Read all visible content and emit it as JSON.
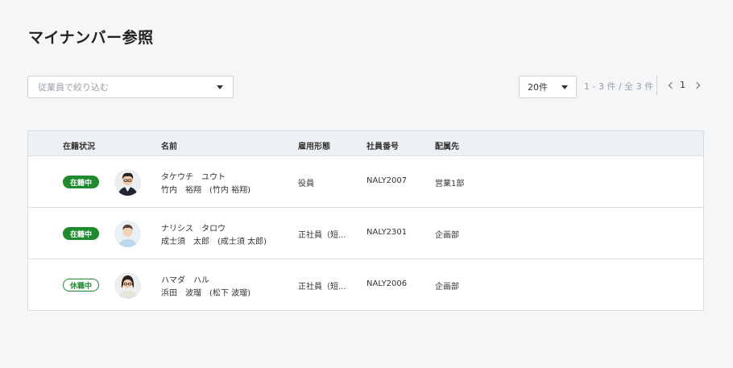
{
  "page": {
    "title": "マイナンバー参照"
  },
  "filter": {
    "placeholder": "従業員で絞り込む"
  },
  "pagination": {
    "per_page": "20件",
    "range": "1 - 3 件 / 全 3 件",
    "current_page": "1"
  },
  "table": {
    "headers": {
      "status": "在籍状況",
      "name": "名前",
      "employment": "雇用形態",
      "employee_no": "社員番号",
      "department": "配属先"
    },
    "rows": [
      {
        "status": "在籍中",
        "status_type": "active",
        "name_kana": "タケウチ　ユウト",
        "name_kanji": "竹内　裕翔　(竹内 裕翔)",
        "employment": "役員",
        "employee_no": "NALY2007",
        "department": "営業1部"
      },
      {
        "status": "在籍中",
        "status_type": "active",
        "name_kana": "ナリシス　タロウ",
        "name_kanji": "成士須　太郎　(成士須 太郎)",
        "employment": "正社員（短...",
        "employee_no": "NALY2301",
        "department": "企画部"
      },
      {
        "status": "休職中",
        "status_type": "leave",
        "name_kana": "ハマダ　ハル",
        "name_kanji": "浜田　波瑠　(松下 波瑠)",
        "employment": "正社員（短...",
        "employee_no": "NALY2006",
        "department": "企画部"
      }
    ]
  },
  "colors": {
    "active_badge": "#1e8a2e",
    "background": "#f5f6f8",
    "header_bg": "#eef1f4"
  }
}
